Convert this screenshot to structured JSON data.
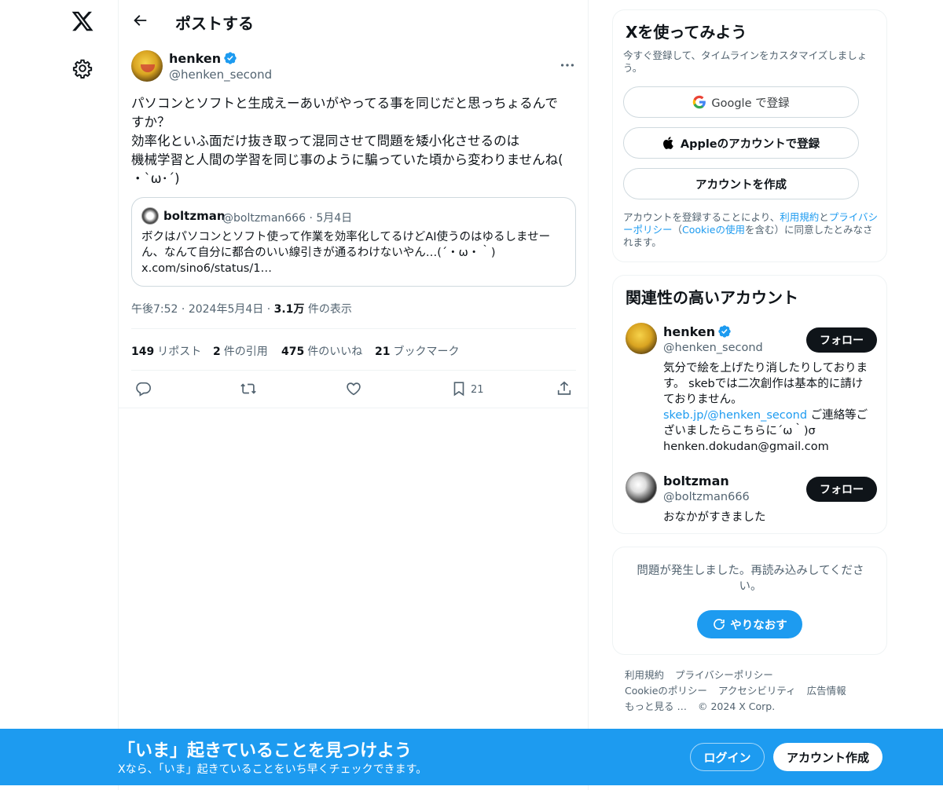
{
  "nav": {
    "logo_icon": "x-logo-icon",
    "settings_icon": "gear-icon"
  },
  "header": {
    "title": "ポストする",
    "back_icon": "arrow-left-icon"
  },
  "post": {
    "author_name": "henken",
    "author_handle": "@henken_second",
    "text": "パソコンとソフトと生成えーあいがやってる事を同じだと思っちょるんで\nすか？\n効率化といふ面だけ抜き取って混同させて問題を矮小化させるのは\n機械学習と人間の学習を同じ事のように騙っていた頃から変わりませんね(\n・`ω･´)",
    "time": "午後7:52",
    "date": "2024年5月4日",
    "views_count": "3.1万",
    "views_label": "件の表示",
    "quote": {
      "name": "boltzman",
      "handle_date": "@boltzman666 · 5月4日",
      "text": "ボクはパソコンとソフト使って作業を効率化してるけどAI使うのはゆるしませー\nん、なんて自分に都合のいい線引きが通るわけないやん…(´・ω・｀)\nx.com/sino6/status/1…"
    },
    "stats": {
      "reposts_count": "149",
      "reposts_label": "リポスト",
      "quotes_count": "2",
      "quotes_label": "件の引用",
      "likes_count": "475",
      "likes_label": "件のいいね",
      "bookmarks_count": "21",
      "bookmarks_label": "ブックマーク"
    },
    "bookmark_action_count": "21"
  },
  "signup_card": {
    "title": "Xを使ってみよう",
    "subtitle": "今すぐ登録して、タイムラインをカスタマイズしましょう。",
    "google_label": "Google で登録",
    "apple_label": "Appleのアカウントで登録",
    "create_label": "アカウントを作成",
    "legal_pre": "アカウントを登録することにより、",
    "legal_terms": "利用規約",
    "legal_and": "と",
    "legal_privacy": "プライバシーポリシー",
    "legal_mid": "（",
    "legal_cookie": "Cookieの使用",
    "legal_post": "を含む）に同意したとみなされます。"
  },
  "related": {
    "title": "関連性の高いアカウント",
    "follow_label": "フォロー",
    "accounts": [
      {
        "name": "henken",
        "handle": "@henken_second",
        "bio_pre": "気分で絵を上げたり消したりしております。 skebでは二次創作は基本的に請けておりません。",
        "bio_link": "skeb.jp/@henken_second",
        "bio_post": " ご連絡等ございましたらこちらに´ω｀)σ henken.dokudan@gmail.com"
      },
      {
        "name": "boltzman",
        "handle": "@boltzman666",
        "bio_pre": "おなかがすきました"
      }
    ]
  },
  "error_card": {
    "message": "問題が発生しました。再読み込みしてください。",
    "retry_label": "やりなおす"
  },
  "footer": {
    "links": [
      "利用規約",
      "プライバシーポリシー",
      "Cookieのポリシー",
      "アクセシビリティ",
      "広告情報",
      "もっと見る …",
      "© 2024 X Corp."
    ]
  },
  "banner": {
    "title": "「いま」起きていることを見つけよう",
    "subtitle": "Xなら、「いま」起きていることをいち早くチェックできます。",
    "login_label": "ログイン",
    "signup_label": "アカウント作成"
  },
  "colors": {
    "accent": "#1d9bf0",
    "text": "#0f1419",
    "muted": "#536471",
    "border": "#eff3f4"
  }
}
